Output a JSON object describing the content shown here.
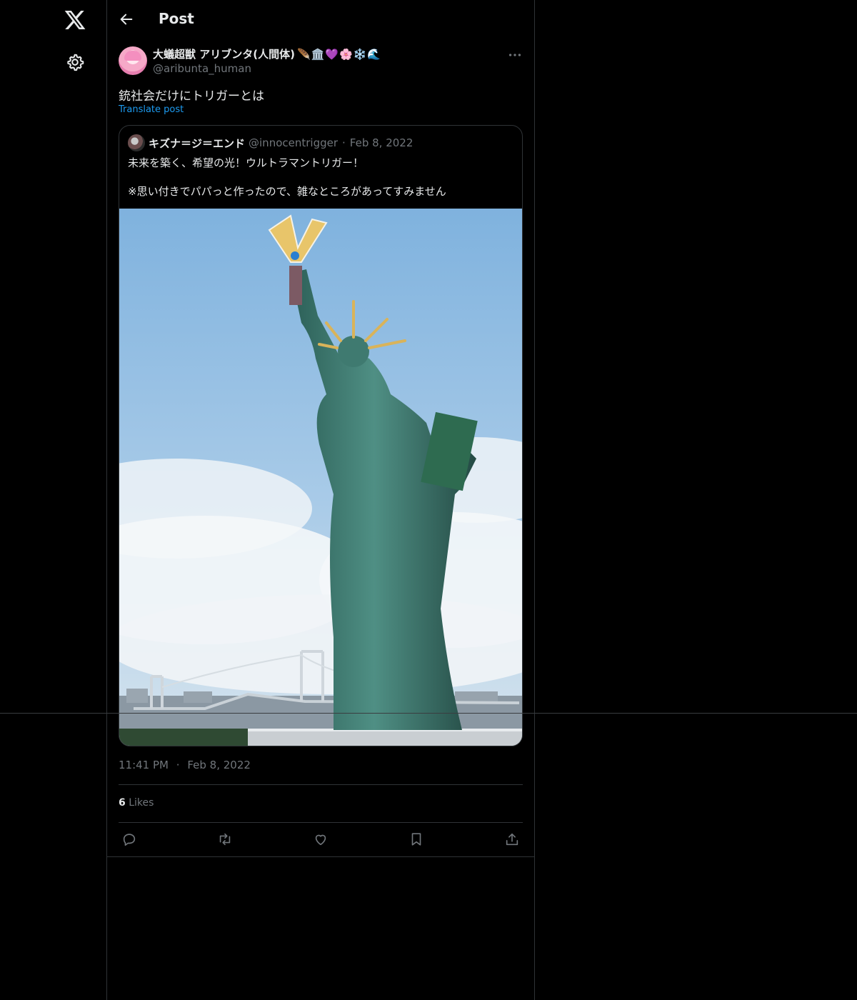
{
  "header": {
    "title": "Post"
  },
  "post": {
    "display_name": "大蟻超獣 アリブンタ(人間体)",
    "emojis": "🪶🏛️💜🌸❄️🌊",
    "handle": "@aribunta_human",
    "text": "銃社会だけにトリガーとは",
    "translate_label": "Translate post",
    "time": "11:41 PM",
    "date": "Feb 8, 2022",
    "likes_count": "6",
    "likes_label": "Likes"
  },
  "quote": {
    "display_name": "キズナ＝ジ＝エンド",
    "handle": "@innocentrigger",
    "date": "Feb 8, 2022",
    "line1": "未来を築く、希望の光！ウルトラマントリガー！",
    "line2": "※思い付きでパパっと作ったので、雑なところがあってすみません"
  },
  "separator": "·",
  "icons": {
    "logo": "x-logo-icon",
    "settings": "gear-icon",
    "back": "arrow-left-icon",
    "more": "more-horizontal-icon",
    "reply": "reply-icon",
    "repost": "repost-icon",
    "like": "heart-icon",
    "bookmark": "bookmark-icon",
    "share": "share-icon"
  },
  "colors": {
    "background": "#000000",
    "text": "#e7e9ea",
    "muted": "#71767b",
    "link": "#1d9bf0",
    "border": "#2f3336"
  }
}
